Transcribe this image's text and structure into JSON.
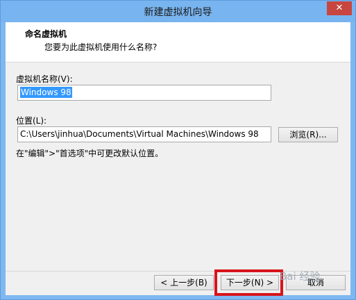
{
  "window": {
    "title": "新建虚拟机向导",
    "close_glyph": "✕"
  },
  "header": {
    "title": "命名虚拟机",
    "subtitle": "您要为此虚拟机使用什么名称?"
  },
  "vm_name": {
    "label": "虚拟机名称(V):",
    "value": "Windows 98"
  },
  "location": {
    "label": "位置(L):",
    "value": "C:\\Users\\jinhua\\Documents\\Virtual Machines\\Windows 98",
    "browse_label": "浏览(R)...",
    "hint": "在\"编辑\">\"首选项\"中可更改默认位置。"
  },
  "footer": {
    "back_label": "< 上一步(B)",
    "next_label": "下一步(N) >",
    "cancel_label": "取消"
  },
  "watermark": "Bai 经验",
  "colors": {
    "highlight": "#d9141b",
    "titlebar": "#78b4ef",
    "selection": "#3399ff"
  }
}
